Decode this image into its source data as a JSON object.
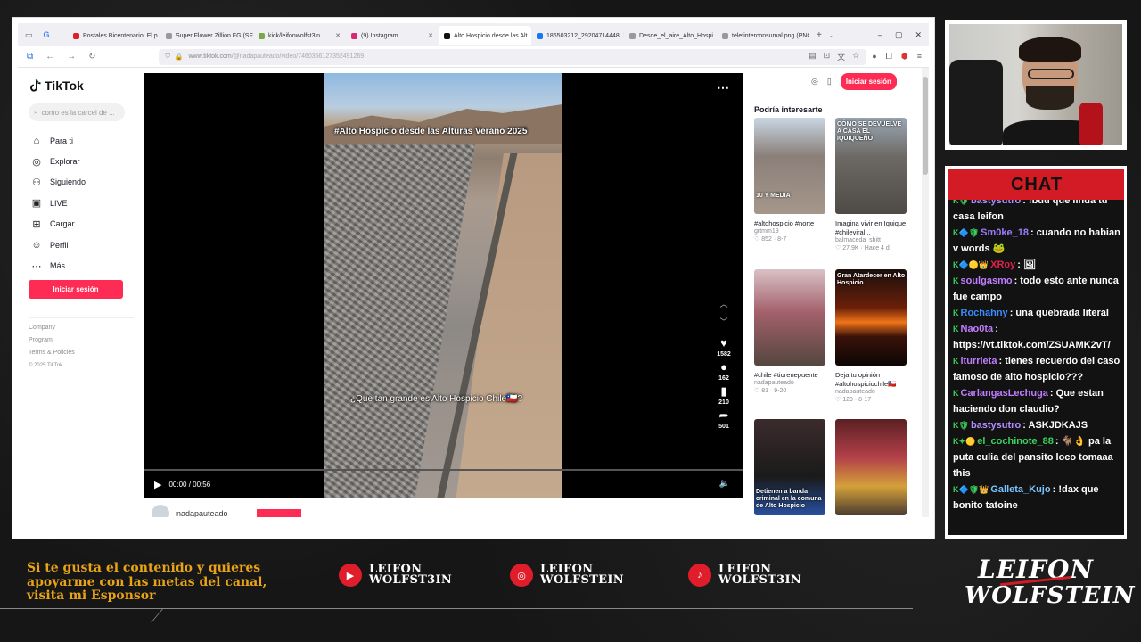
{
  "colors": {
    "tiktok_red": "#fe2c55",
    "accent_orange": "#e8a317",
    "overlay_red": "#d21b24"
  },
  "browser": {
    "tabs": [
      {
        "label": "Postales Bicentenario: El p",
        "icon": "youtube-icon",
        "color": "#e01e2b"
      },
      {
        "label": "Super Flower Zillion FG (SF",
        "icon": "page-icon",
        "color": "#999999"
      },
      {
        "label": "kick/leifonwolfst3in",
        "icon": "kick-icon",
        "color": "#7a4"
      },
      {
        "label": "(9) Instagram",
        "icon": "instagram-icon",
        "color": "#d62976"
      },
      {
        "label": "Alto Hospicio desde las Alt",
        "icon": "tiktok-icon",
        "color": "#111111",
        "active": true
      },
      {
        "label": "186503212_29204714448",
        "icon": "facebook-icon",
        "color": "#1877f2"
      },
      {
        "label": "Desde_el_aire_Alto_Hospi",
        "icon": "page-icon",
        "color": "#999999"
      },
      {
        "label": "telefinterconsumal.png (PNG In",
        "icon": "image-icon",
        "color": "#999999"
      }
    ],
    "url_host": "www.tiktok.com",
    "url_path": "/@nadapauteado/video/7460356127352491269"
  },
  "tiktok": {
    "brand": "TikTok",
    "search_placeholder": "como es la carcel de ...",
    "menu": [
      {
        "label": "Para ti",
        "icon": "home-icon"
      },
      {
        "label": "Explorar",
        "icon": "compass-icon"
      },
      {
        "label": "Siguiendo",
        "icon": "following-icon"
      },
      {
        "label": "LIVE",
        "icon": "live-icon"
      },
      {
        "label": "Cargar",
        "icon": "upload-icon"
      },
      {
        "label": "Perfil",
        "icon": "profile-icon"
      },
      {
        "label": "Más",
        "icon": "more-icon"
      }
    ],
    "login_label": "Iniciar sesión",
    "footer": {
      "company": "Company",
      "program": "Program",
      "terms": "Terms & Policies",
      "copyright": "© 2025 TikTok"
    },
    "video": {
      "caption_top": "#Alto Hospicio desde las Alturas Verano 2025",
      "caption_bottom": "¿Que tan grande es Alto Hospicio Chile🇨🇱?",
      "likes": "1582",
      "comments": "162",
      "saves": "210",
      "shares": "501",
      "time": "00:00 / 00:56",
      "progress": 0.0,
      "author": "nadapauteado"
    },
    "right": {
      "login_label": "Iniciar sesión",
      "title": "Podría interesarte",
      "cards": [
        {
          "caption": "#altohospicio #norte",
          "user": "grtmm19",
          "likes": "852",
          "date": "8-7",
          "overlay": "10 Y MEDIA",
          "bg": "linear-gradient(180deg,#c9d6e3 0%,#8a7f79 40%,#a6978b 100%)"
        },
        {
          "caption": "Imagina vivir en Iquique #chileviral...",
          "user": "balmaceda_shitt",
          "likes": "27.9K",
          "date": "Hace 4 d",
          "overlay": "CÓMO SE DEVUELVE A CASA EL IQUIQUEÑO",
          "bg": "linear-gradient(180deg,#9aa7b3 0%,#6d6a66 40%,#4e4a46 100%)"
        },
        {
          "caption": "#chile #tiorenepuente",
          "user": "nadapauteado",
          "likes": "81",
          "date": "9-20",
          "overlay": "",
          "bg": "linear-gradient(180deg,#d9c1c6 0%,#a3606b 45%,#54463f 100%)"
        },
        {
          "caption": "Deja tu opinión #altohospiciochile🇨🇱",
          "user": "nadapauteado",
          "likes": "129",
          "date": "8-17",
          "overlay": "Gran Atardecer en Alto Hospicio",
          "bg": "linear-gradient(180deg,#1a0f0c 0%,#6b1f09 40%,#f07418 55%,#3a120a 70%,#0c0605 100%)"
        },
        {
          "caption": "",
          "user": "",
          "likes": "",
          "date": "",
          "overlay": "Detienen a banda criminal en la comuna de Alto Hospicio",
          "bg": "linear-gradient(180deg,#3b2b2d 0%,#1a1a1a 60%,#2850a0 100%)"
        },
        {
          "caption": "",
          "user": "",
          "likes": "",
          "date": "",
          "overlay": "",
          "bg": "linear-gradient(180deg,#5a2022 0%,#b4414a 40%,#d4a03a 70%,#4b3b30 100%)"
        }
      ]
    }
  },
  "chat": {
    "title": "CHAT",
    "messages": [
      {
        "badges": "K🛡",
        "user": "bastysutro",
        "color": "#b28cff",
        "text": ": !buu que linda tu casa leifon"
      },
      {
        "badges": "K🔷🛡",
        "user": "Sm0ke_18",
        "color": "#9b7cff",
        "text": ": cuando no habian v words 🐸"
      },
      {
        "badges": "K🔷🟡👑",
        "user": "XRoy",
        "color": "#e0224a",
        "text": ": 🖼"
      },
      {
        "badges": "K",
        "user": "soulgasmo",
        "color": "#c07dff",
        "text": ": todo esto ante nunca fue campo"
      },
      {
        "badges": "K",
        "user": "Rochahny",
        "color": "#3a8cff",
        "text": ": una quebrada literal"
      },
      {
        "badges": "K",
        "user": "Nao0ta",
        "color": "#c07dff",
        "text": ": https://vt.tiktok.com/ZSUAMK2vT/"
      },
      {
        "badges": "K",
        "user": "iturrieta",
        "color": "#c07dff",
        "text": ": tienes recuerdo del caso famoso de alto hospicio???"
      },
      {
        "badges": "K",
        "user": "CarlangasLechuga",
        "color": "#c07dff",
        "text": ": Que estan haciendo don claudio?"
      },
      {
        "badges": "K🛡",
        "user": "bastysutro",
        "color": "#b28cff",
        "text": ": ASKJDKAJS"
      },
      {
        "badges": "K✦🟡",
        "user": "el_cochinote_88",
        "color": "#3bd15c",
        "text": ": 🐐👌 pa la puta culia del pansito loco tomaaa this"
      },
      {
        "badges": "K🔷🛡👑",
        "user": "Galleta_Kujo",
        "color": "#7ac4ff",
        "text": ": !dax que bonito tatoine"
      }
    ]
  },
  "overlay": {
    "sponsor_text": "Si te gusta el contenido y quieres apoyarme con las metas del canal, visita mi Esponsor",
    "socials": [
      {
        "platform": "youtube",
        "icon": "youtube-icon",
        "line1": "LEIFON",
        "line2": "WOLFST3IN"
      },
      {
        "platform": "instagram",
        "icon": "instagram-icon",
        "line1": "LEIFON",
        "line2": "WOLFSTEIN"
      },
      {
        "platform": "tiktok",
        "icon": "tiktok-icon",
        "line1": "LEIFON",
        "line2": "WOLFST3IN"
      }
    ],
    "brand_line1": "LEIFON",
    "brand_line2": "WOLFSTEIN"
  }
}
